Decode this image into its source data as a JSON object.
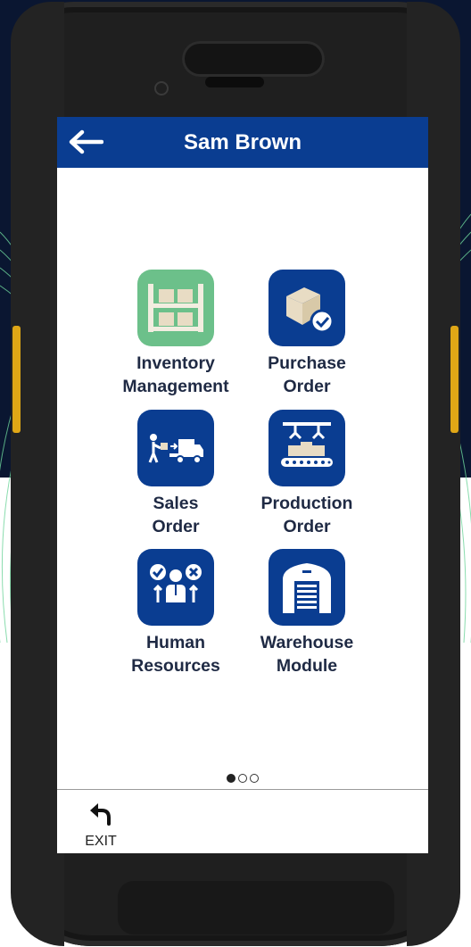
{
  "header": {
    "title": "Sam Brown"
  },
  "tiles": [
    {
      "label": "Inventory\nManagement"
    },
    {
      "label": "Purchase\nOrder"
    },
    {
      "label": "Sales\nOrder"
    },
    {
      "label": "Production\nOrder"
    },
    {
      "label": "Human\nResources"
    },
    {
      "label": "Warehouse\nModule"
    }
  ],
  "pager": {
    "current": 1,
    "total": 3
  },
  "footer": {
    "exit_label": "EXIT"
  },
  "colors": {
    "brand": "#0a3d91",
    "inventory_tile": "#6cc08a",
    "background_top": "#0a1631",
    "side_key": "#e0a716"
  }
}
